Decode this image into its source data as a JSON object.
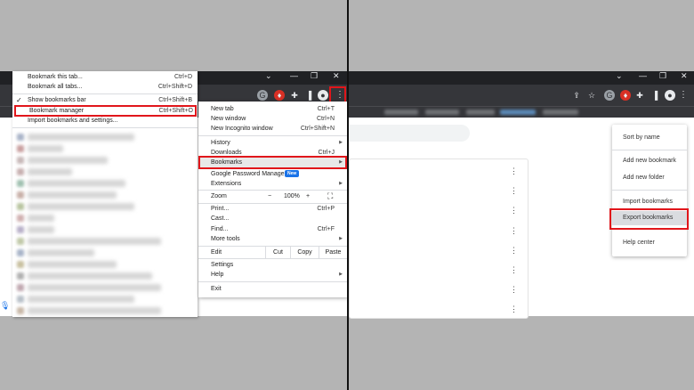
{
  "left_panel": {
    "window_controls": [
      "⌄",
      "—",
      "❐",
      "✕"
    ],
    "toolbar_icons": [
      "google-icon",
      "shield-icon",
      "extensions-icon",
      "sidebar-icon",
      "profile-icon",
      "more-icon"
    ],
    "bookmark_submenu": {
      "top_items": [
        {
          "label": "Bookmark this tab...",
          "shortcut": "Ctrl+D"
        },
        {
          "label": "Bookmark all tabs...",
          "shortcut": "Ctrl+Shift+D"
        }
      ],
      "show_bar": {
        "label": "Show bookmarks bar",
        "shortcut": "Ctrl+Shift+B",
        "check": "✓"
      },
      "manager": {
        "label": "Bookmark manager",
        "shortcut": "Ctrl+Shift+O"
      },
      "import": {
        "label": "Import bookmarks and settings..."
      }
    },
    "main_menu": {
      "new_tab": {
        "label": "New tab",
        "shortcut": "Ctrl+T"
      },
      "new_window": {
        "label": "New window",
        "shortcut": "Ctrl+N"
      },
      "incognito": {
        "label": "New Incognito window",
        "shortcut": "Ctrl+Shift+N"
      },
      "history": {
        "label": "History"
      },
      "downloads": {
        "label": "Downloads",
        "shortcut": "Ctrl+J"
      },
      "bookmarks": {
        "label": "Bookmarks"
      },
      "password_manager": {
        "label": "Google Password Manager",
        "badge": "New"
      },
      "extensions": {
        "label": "Extensions"
      },
      "zoom": {
        "label": "Zoom",
        "minus": "−",
        "value": "100%",
        "plus": "+",
        "fullscreen": "⛶"
      },
      "print": {
        "label": "Print...",
        "shortcut": "Ctrl+P"
      },
      "cast": {
        "label": "Cast..."
      },
      "find": {
        "label": "Find...",
        "shortcut": "Ctrl+F"
      },
      "more_tools": {
        "label": "More tools"
      },
      "edit": {
        "label": "Edit",
        "cut": "Cut",
        "copy": "Copy",
        "paste": "Paste"
      },
      "settings": {
        "label": "Settings"
      },
      "help": {
        "label": "Help"
      },
      "exit": {
        "label": "Exit"
      },
      "submenu_arrow": "▶"
    },
    "highlight_color": "#e1161b"
  },
  "right_panel": {
    "window_controls": [
      "⌄",
      "—",
      "❐",
      "✕"
    ],
    "toolbar_icons": [
      "share-icon",
      "star-icon",
      "google-icon",
      "shield-icon",
      "extensions-icon",
      "sidebar-icon",
      "profile-icon",
      "more-icon"
    ],
    "kebab": "⋮",
    "organize_menu": {
      "sort": "Sort by name",
      "add_bookmark": "Add new bookmark",
      "add_folder": "Add new folder",
      "import": "Import bookmarks",
      "export": "Export bookmarks",
      "help": "Help center"
    }
  }
}
